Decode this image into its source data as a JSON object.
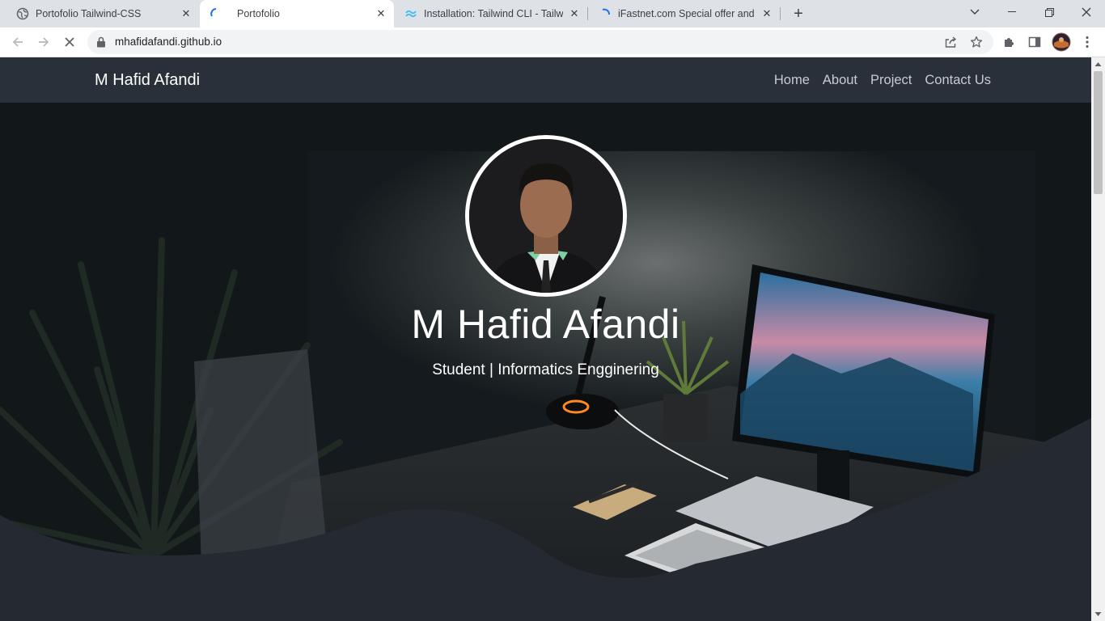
{
  "browser": {
    "tabs": [
      {
        "title": "Portofolio Tailwind-CSS",
        "favicon": "globe-icon",
        "active": false
      },
      {
        "title": "Portofolio",
        "favicon": "loading-spinner-icon",
        "active": true
      },
      {
        "title": "Installation: Tailwind CLI - Tailwind CSS",
        "favicon": "tailwind-icon",
        "active": false
      },
      {
        "title": "iFastnet.com Special offer and Discounts",
        "favicon": "loading-spinner-icon",
        "active": false
      }
    ],
    "url": "mhafidafandi.github.io",
    "accent_color": "#1a73e8"
  },
  "page": {
    "navbar": {
      "brand": "M Hafid Afandi",
      "links": [
        "Home",
        "About",
        "Project",
        "Contact Us"
      ]
    },
    "hero": {
      "name": "M Hafid Afandi",
      "subtitle": "Student | Informatics Engginering"
    },
    "colors": {
      "navbar": "#2a3039",
      "page_bg": "#252a32"
    }
  }
}
